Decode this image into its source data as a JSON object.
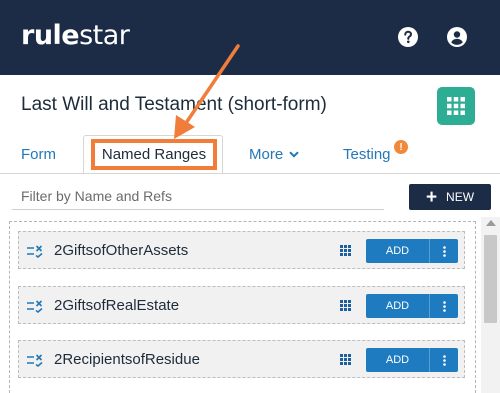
{
  "app": {
    "logo_bold": "rule",
    "logo_regular": "star",
    "help_icon": "help-circle-icon",
    "user_icon": "account-circle-icon"
  },
  "document": {
    "title": "Last Will and Testament (short-form)",
    "grid_icon": "apps-grid-icon"
  },
  "tabs": [
    {
      "label": "Form",
      "active": false
    },
    {
      "label": "Named Ranges",
      "active": true
    },
    {
      "label": "More",
      "active": false,
      "has_dropdown": true
    },
    {
      "label": "Testing",
      "active": false,
      "badge": "!"
    }
  ],
  "filter": {
    "placeholder": "Filter by Name and Refs",
    "value": ""
  },
  "new_button": {
    "label": "NEW",
    "icon": "plus-icon"
  },
  "named_ranges": [
    {
      "name": "2GiftsofOtherAssets",
      "add_label": "ADD"
    },
    {
      "name": "2GiftsofRealEstate",
      "add_label": "ADD"
    },
    {
      "name": "2RecipientsofResidue",
      "add_label": "ADD"
    }
  ],
  "colors": {
    "header_bg": "#1d2c46",
    "accent_teal": "#2dad94",
    "link_blue": "#2478b5",
    "button_blue": "#1f7bbf",
    "highlight_orange": "#f07d3a",
    "badge_orange": "#f08a3a"
  }
}
